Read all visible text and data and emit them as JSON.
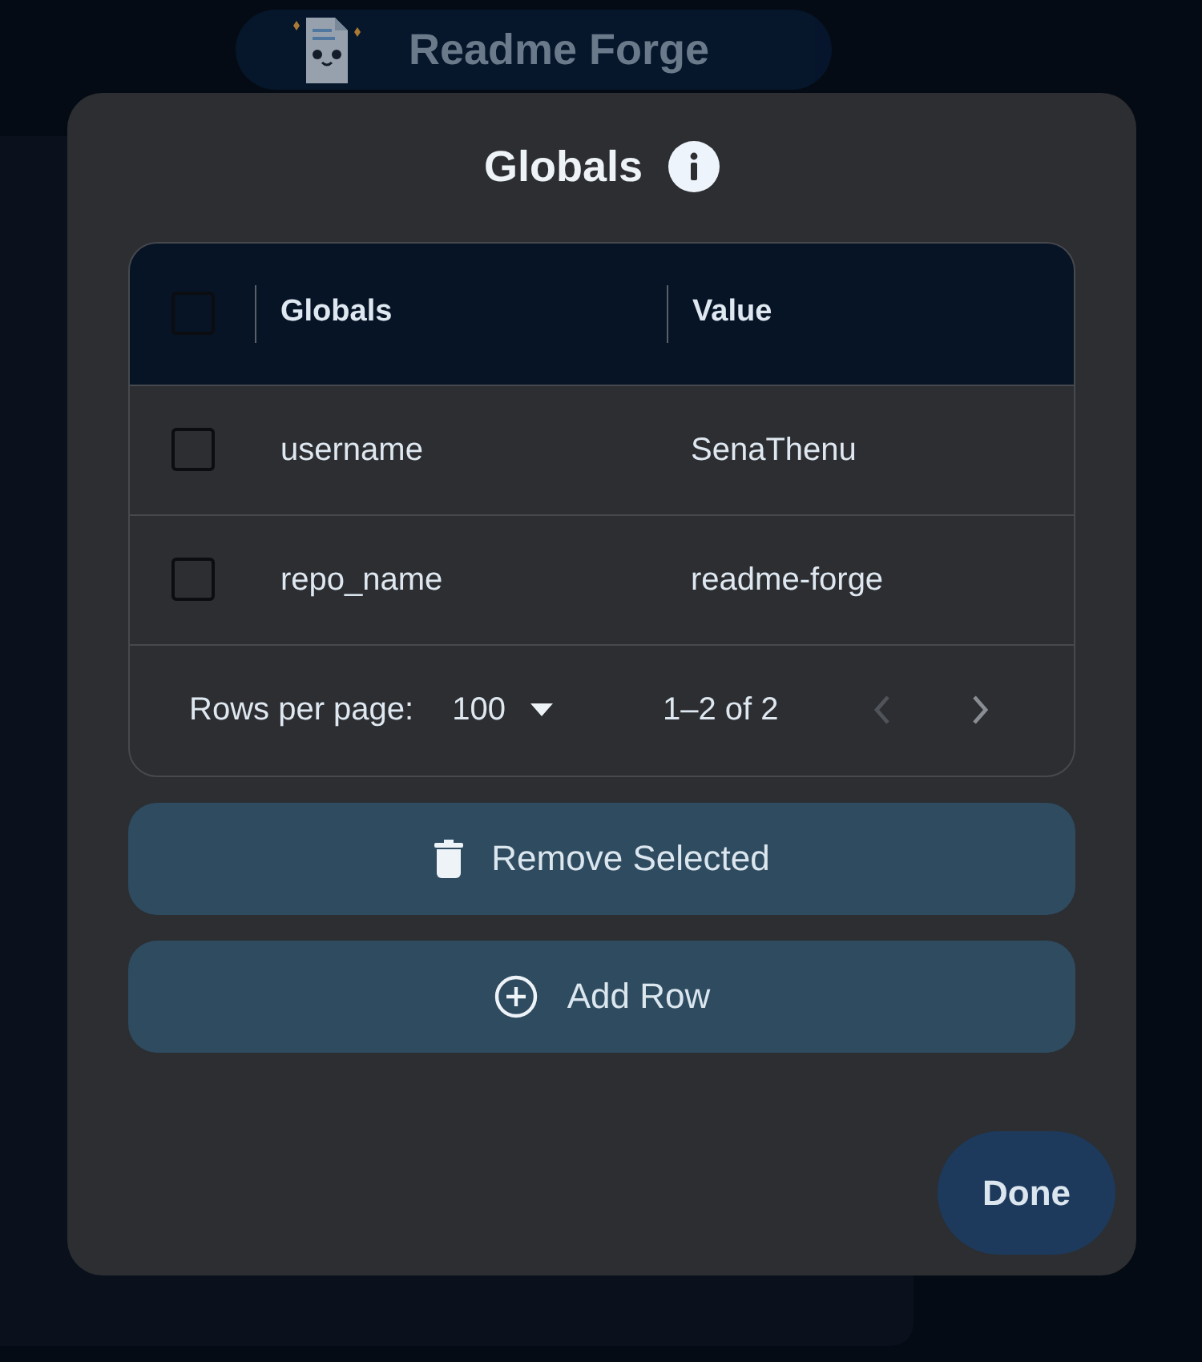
{
  "app_header": {
    "title": "Readme Forge"
  },
  "dialog": {
    "title": "Globals"
  },
  "table": {
    "select_all": {
      "checked": false
    },
    "columns": [
      "Globals",
      "Value"
    ],
    "rows": [
      {
        "cells": [
          "username",
          "SenaThenu"
        ],
        "checked": false
      },
      {
        "cells": [
          "repo_name",
          "readme-forge"
        ],
        "checked": false
      }
    ]
  },
  "pagination": {
    "rows_per_page_label": "Rows per page:",
    "rows_per_page": "100",
    "range": "1–2 of 2",
    "previous_disabled": true,
    "next_disabled": false
  },
  "buttons": [
    {
      "kind": "remove",
      "label": "Remove Selected"
    },
    {
      "kind": "add",
      "label": "Add Row"
    }
  ],
  "done_button": "Done"
}
